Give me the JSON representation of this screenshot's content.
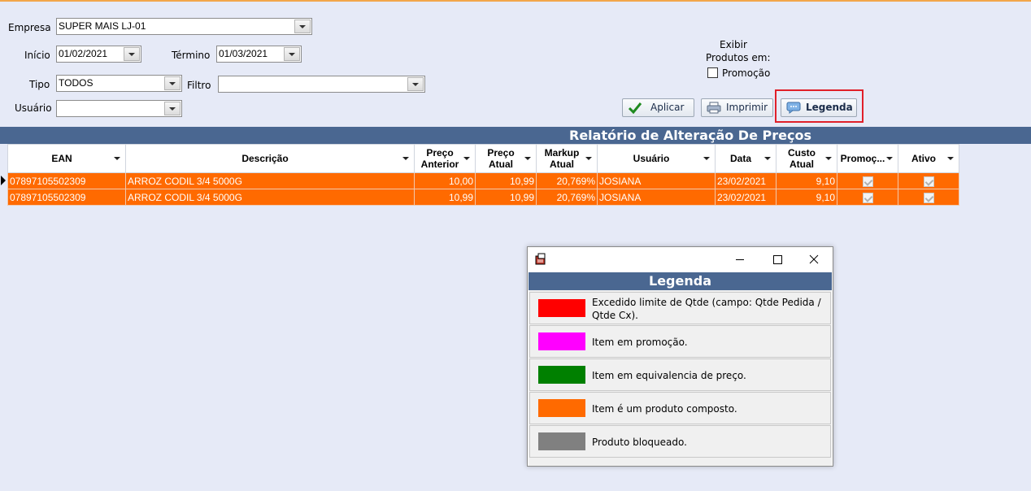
{
  "form": {
    "empresa_label": "Empresa",
    "empresa_value": "SUPER MAIS LJ-01",
    "inicio_label": "Início",
    "inicio_value": "01/02/2021",
    "termino_label": "Término",
    "termino_value": "01/03/2021",
    "tipo_label": "Tipo",
    "tipo_value": "TODOS",
    "filtro_label": "Filtro",
    "filtro_value": "",
    "usuario_label": "Usuário",
    "usuario_value": "",
    "exibir_label_1": "Exibir",
    "exibir_label_2": "Produtos em:",
    "promocao_label": "Promoção",
    "promocao_checked": false
  },
  "toolbar": {
    "aplicar_label": "Aplicar",
    "imprimir_label": "Imprimir",
    "legenda_label": "Legenda"
  },
  "grid": {
    "title": "Relatório de Alteração De Preços",
    "columns": [
      {
        "label": "EAN"
      },
      {
        "label": "Descrição"
      },
      {
        "label": "Preço\nAnterior"
      },
      {
        "label": "Preço\nAtual"
      },
      {
        "label": "Markup\nAtual"
      },
      {
        "label": "Usuário"
      },
      {
        "label": "Data"
      },
      {
        "label": "Custo\nAtual"
      },
      {
        "label": "Promoç..."
      },
      {
        "label": "Ativo"
      }
    ],
    "rows": [
      {
        "ean": "07897105502309",
        "descricao": "ARROZ CODIL 3/4 5000G",
        "preco_anterior": "10,00",
        "preco_atual": "10,99",
        "markup": "20,769%",
        "usuario": "JOSIANA",
        "data": "23/02/2021",
        "custo": "9,10",
        "promocao": true,
        "ativo": true
      },
      {
        "ean": "07897105502309",
        "descricao": "ARROZ CODIL 3/4 5000G",
        "preco_anterior": "10,99",
        "preco_atual": "10,99",
        "markup": "20,769%",
        "usuario": "JOSIANA",
        "data": "23/02/2021",
        "custo": "9,10",
        "promocao": true,
        "ativo": true
      }
    ],
    "row_color": "#ff6a00"
  },
  "legend_dialog": {
    "title": "Legenda",
    "items": [
      {
        "color": "#ff0000",
        "text": "Excedido limite de Qtde (campo: Qtde Pedida / Qtde Cx)."
      },
      {
        "color": "#ff00ff",
        "text": "Item em promoção."
      },
      {
        "color": "#008000",
        "text": "Item em equivalencia de preço."
      },
      {
        "color": "#ff6a00",
        "text": "Item é um produto composto."
      },
      {
        "color": "#808080",
        "text": "Produto bloqueado."
      }
    ]
  },
  "colors": {
    "header_bar": "#4a6791",
    "background": "#e6eaf7",
    "highlight_border": "#e0202a"
  }
}
